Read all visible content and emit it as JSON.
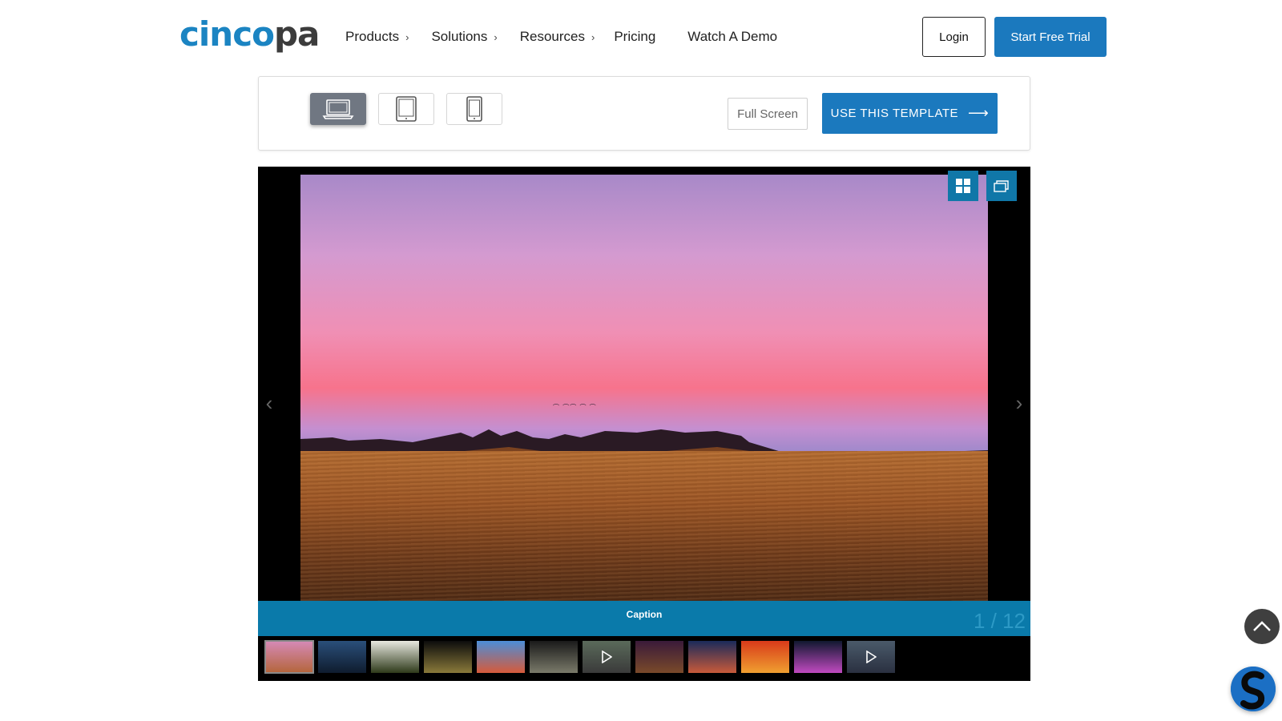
{
  "header": {
    "logo": {
      "part1": "cinco",
      "part2": "pa"
    },
    "nav": [
      {
        "label": "Products",
        "has_submenu": true
      },
      {
        "label": "Solutions",
        "has_submenu": true
      },
      {
        "label": "Resources",
        "has_submenu": true
      },
      {
        "label": "Pricing",
        "has_submenu": false
      },
      {
        "label": "Watch A Demo",
        "has_submenu": false
      }
    ],
    "login_label": "Login",
    "trial_label": "Start Free Trial"
  },
  "toolbar": {
    "devices": [
      {
        "name": "laptop-icon",
        "active": true
      },
      {
        "name": "tablet-icon",
        "active": false
      },
      {
        "name": "phone-icon",
        "active": false
      }
    ],
    "fullscreen_label": "Full Screen",
    "template_label": "USE THIS TEMPLATE",
    "template_arrow": "⟶"
  },
  "gallery": {
    "caption": "Caption",
    "counter": "1 / 12",
    "current_index": 1,
    "total": 12,
    "thumbnails": [
      {
        "name": "sunset-field",
        "colors": [
          "#d68ab8",
          "#b4653a"
        ],
        "video": false
      },
      {
        "name": "bridge-night",
        "colors": [
          "#2a4f7a",
          "#0f1c2e"
        ],
        "video": false
      },
      {
        "name": "daisy",
        "colors": [
          "#e8e8e0",
          "#2e3a1a"
        ],
        "video": false
      },
      {
        "name": "bee",
        "colors": [
          "#0c0c0c",
          "#8a7a3a"
        ],
        "video": false
      },
      {
        "name": "flower-blue",
        "colors": [
          "#4c8ed8",
          "#d65a3a"
        ],
        "video": false
      },
      {
        "name": "owl",
        "colors": [
          "#1a1a1a",
          "#7a7a6a"
        ],
        "video": false
      },
      {
        "name": "crowd-video",
        "colors": [
          "#5a6a5a",
          "#3a3a3a"
        ],
        "video": true
      },
      {
        "name": "purple-haze",
        "colors": [
          "#3a1a3a",
          "#7a4a2a"
        ],
        "video": false
      },
      {
        "name": "lake-sunset",
        "colors": [
          "#1a2a5a",
          "#c85a3a"
        ],
        "video": false
      },
      {
        "name": "gerbera",
        "colors": [
          "#d83a1a",
          "#f0a030"
        ],
        "video": false
      },
      {
        "name": "city-night",
        "colors": [
          "#101830",
          "#c04ac0"
        ],
        "video": false
      },
      {
        "name": "skyline-video",
        "colors": [
          "#4a5a6a",
          "#2a3040"
        ],
        "video": true
      }
    ]
  },
  "colors": {
    "brand_blue": "#1b79be",
    "caption_blue": "#0a7aaa",
    "view_btn_blue": "#1077a8"
  }
}
